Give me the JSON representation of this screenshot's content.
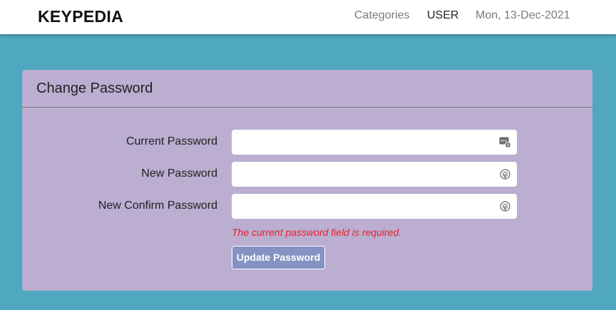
{
  "navbar": {
    "brand": "KEYPEDIA",
    "categories": "Categories",
    "user": "USER",
    "date": "Mon, 13-Dec-2021"
  },
  "form": {
    "title": "Change Password",
    "fields": [
      {
        "label": "Current Password",
        "value": "",
        "icon": "password-manager-key-icon"
      },
      {
        "label": "New Password",
        "value": "",
        "icon": "password-generate-icon"
      },
      {
        "label": "New Confirm Password",
        "value": "",
        "icon": "password-generate-icon"
      }
    ],
    "error": "The current password field is required.",
    "submit_label": "Update Password"
  },
  "colors": {
    "page_background": "#4fa8bf",
    "card_background": "#bbaed1",
    "button_background": "#8592c4",
    "error": "#e8202a"
  }
}
